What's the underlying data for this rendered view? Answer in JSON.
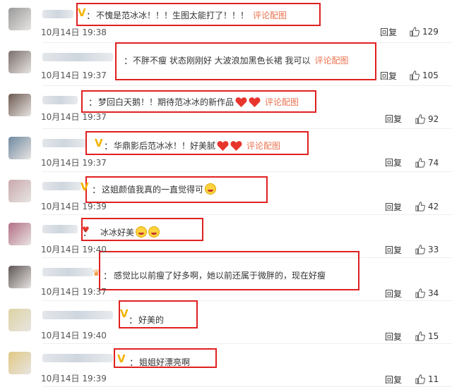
{
  "comments": [
    {
      "text": "不愧是范冰冰！！！生图太能打了！！！",
      "extra": "评论配图",
      "time": "10月14日 19:38",
      "reply": "回复",
      "likes": "129",
      "badge": "vip",
      "avatar_color": "#9a9a9a"
    },
    {
      "text": "不胖不瘦 状态刚刚好 大波浪加黑色长裙 我可以",
      "extra": "评论配图",
      "time": "10月14日 19:37",
      "reply": "回复",
      "likes": "105",
      "badge": "none",
      "avatar_color": "#7a6f6b"
    },
    {
      "text": "梦回白天鹅！！期待范冰冰的新作品",
      "extra": "评论配图",
      "time": "10月14日 19:37",
      "reply": "回复",
      "likes": "92",
      "badge": "none",
      "avatar_color": "#6d5a52",
      "emoji": "heart2"
    },
    {
      "text": "华鼎影后范冰冰！！好美腻",
      "extra": "评论配图",
      "time": "10月14日 19:37",
      "reply": "回复",
      "likes": "74",
      "badge": "vip",
      "avatar_color": "#6f8aa0",
      "emoji": "heart2"
    },
    {
      "text": "这姐颜值我真的一直觉得可",
      "extra": "",
      "time": "10月14日 19:39",
      "reply": "回复",
      "likes": "42",
      "badge": "vip",
      "avatar_color": "#c9a9ad",
      "emoji": "face1"
    },
    {
      "text": "冰冰好美",
      "extra": "",
      "time": "10月14日 19:40",
      "reply": "回复",
      "likes": "33",
      "badge": "heart",
      "avatar_color": "#b46f86",
      "emoji": "face2"
    },
    {
      "text": "感觉比以前瘦了好多啊，她以前还属于微胖的，现在好瘦",
      "extra": "",
      "time": "10月14日 19:37",
      "reply": "回复",
      "likes": "34",
      "badge": "crown",
      "avatar_color": "#5e5656"
    },
    {
      "text": "好美的",
      "extra": "",
      "time": "10月14日 19:40",
      "reply": "回复",
      "likes": "15",
      "badge": "vip",
      "avatar_color": "#ddd3a2"
    },
    {
      "text": "姐姐好漂亮啊",
      "extra": "",
      "time": "10月14日 19:39",
      "reply": "回复",
      "likes": "11",
      "badge": "vip",
      "avatar_color": "#e1c983"
    }
  ],
  "colors": {
    "highlight_border": "#e02020",
    "link": "#eb7350",
    "vip_badge": "#f3b300"
  }
}
